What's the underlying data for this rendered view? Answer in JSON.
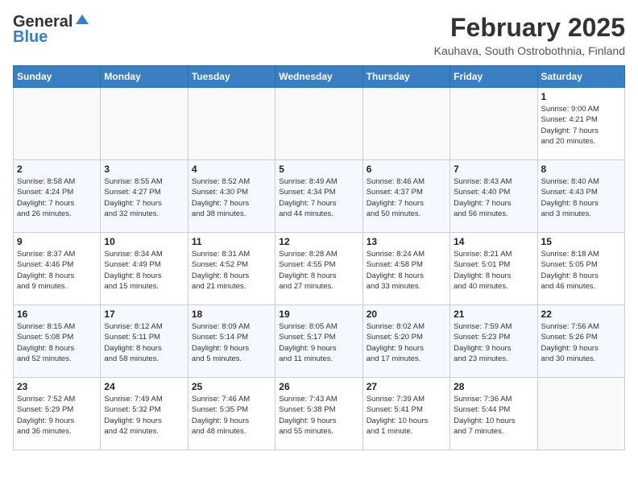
{
  "header": {
    "logo_general": "General",
    "logo_blue": "Blue",
    "month_year": "February 2025",
    "location": "Kauhava, South Ostrobothnia, Finland"
  },
  "weekdays": [
    "Sunday",
    "Monday",
    "Tuesday",
    "Wednesday",
    "Thursday",
    "Friday",
    "Saturday"
  ],
  "weeks": [
    [
      {
        "day": "",
        "info": ""
      },
      {
        "day": "",
        "info": ""
      },
      {
        "day": "",
        "info": ""
      },
      {
        "day": "",
        "info": ""
      },
      {
        "day": "",
        "info": ""
      },
      {
        "day": "",
        "info": ""
      },
      {
        "day": "1",
        "info": "Sunrise: 9:00 AM\nSunset: 4:21 PM\nDaylight: 7 hours\nand 20 minutes."
      }
    ],
    [
      {
        "day": "2",
        "info": "Sunrise: 8:58 AM\nSunset: 4:24 PM\nDaylight: 7 hours\nand 26 minutes."
      },
      {
        "day": "3",
        "info": "Sunrise: 8:55 AM\nSunset: 4:27 PM\nDaylight: 7 hours\nand 32 minutes."
      },
      {
        "day": "4",
        "info": "Sunrise: 8:52 AM\nSunset: 4:30 PM\nDaylight: 7 hours\nand 38 minutes."
      },
      {
        "day": "5",
        "info": "Sunrise: 8:49 AM\nSunset: 4:34 PM\nDaylight: 7 hours\nand 44 minutes."
      },
      {
        "day": "6",
        "info": "Sunrise: 8:46 AM\nSunset: 4:37 PM\nDaylight: 7 hours\nand 50 minutes."
      },
      {
        "day": "7",
        "info": "Sunrise: 8:43 AM\nSunset: 4:40 PM\nDaylight: 7 hours\nand 56 minutes."
      },
      {
        "day": "8",
        "info": "Sunrise: 8:40 AM\nSunset: 4:43 PM\nDaylight: 8 hours\nand 3 minutes."
      }
    ],
    [
      {
        "day": "9",
        "info": "Sunrise: 8:37 AM\nSunset: 4:46 PM\nDaylight: 8 hours\nand 9 minutes."
      },
      {
        "day": "10",
        "info": "Sunrise: 8:34 AM\nSunset: 4:49 PM\nDaylight: 8 hours\nand 15 minutes."
      },
      {
        "day": "11",
        "info": "Sunrise: 8:31 AM\nSunset: 4:52 PM\nDaylight: 8 hours\nand 21 minutes."
      },
      {
        "day": "12",
        "info": "Sunrise: 8:28 AM\nSunset: 4:55 PM\nDaylight: 8 hours\nand 27 minutes."
      },
      {
        "day": "13",
        "info": "Sunrise: 8:24 AM\nSunset: 4:58 PM\nDaylight: 8 hours\nand 33 minutes."
      },
      {
        "day": "14",
        "info": "Sunrise: 8:21 AM\nSunset: 5:01 PM\nDaylight: 8 hours\nand 40 minutes."
      },
      {
        "day": "15",
        "info": "Sunrise: 8:18 AM\nSunset: 5:05 PM\nDaylight: 8 hours\nand 46 minutes."
      }
    ],
    [
      {
        "day": "16",
        "info": "Sunrise: 8:15 AM\nSunset: 5:08 PM\nDaylight: 8 hours\nand 52 minutes."
      },
      {
        "day": "17",
        "info": "Sunrise: 8:12 AM\nSunset: 5:11 PM\nDaylight: 8 hours\nand 58 minutes."
      },
      {
        "day": "18",
        "info": "Sunrise: 8:09 AM\nSunset: 5:14 PM\nDaylight: 9 hours\nand 5 minutes."
      },
      {
        "day": "19",
        "info": "Sunrise: 8:05 AM\nSunset: 5:17 PM\nDaylight: 9 hours\nand 11 minutes."
      },
      {
        "day": "20",
        "info": "Sunrise: 8:02 AM\nSunset: 5:20 PM\nDaylight: 9 hours\nand 17 minutes."
      },
      {
        "day": "21",
        "info": "Sunrise: 7:59 AM\nSunset: 5:23 PM\nDaylight: 9 hours\nand 23 minutes."
      },
      {
        "day": "22",
        "info": "Sunrise: 7:56 AM\nSunset: 5:26 PM\nDaylight: 9 hours\nand 30 minutes."
      }
    ],
    [
      {
        "day": "23",
        "info": "Sunrise: 7:52 AM\nSunset: 5:29 PM\nDaylight: 9 hours\nand 36 minutes."
      },
      {
        "day": "24",
        "info": "Sunrise: 7:49 AM\nSunset: 5:32 PM\nDaylight: 9 hours\nand 42 minutes."
      },
      {
        "day": "25",
        "info": "Sunrise: 7:46 AM\nSunset: 5:35 PM\nDaylight: 9 hours\nand 48 minutes."
      },
      {
        "day": "26",
        "info": "Sunrise: 7:43 AM\nSunset: 5:38 PM\nDaylight: 9 hours\nand 55 minutes."
      },
      {
        "day": "27",
        "info": "Sunrise: 7:39 AM\nSunset: 5:41 PM\nDaylight: 10 hours\nand 1 minute."
      },
      {
        "day": "28",
        "info": "Sunrise: 7:36 AM\nSunset: 5:44 PM\nDaylight: 10 hours\nand 7 minutes."
      },
      {
        "day": "",
        "info": ""
      }
    ]
  ]
}
